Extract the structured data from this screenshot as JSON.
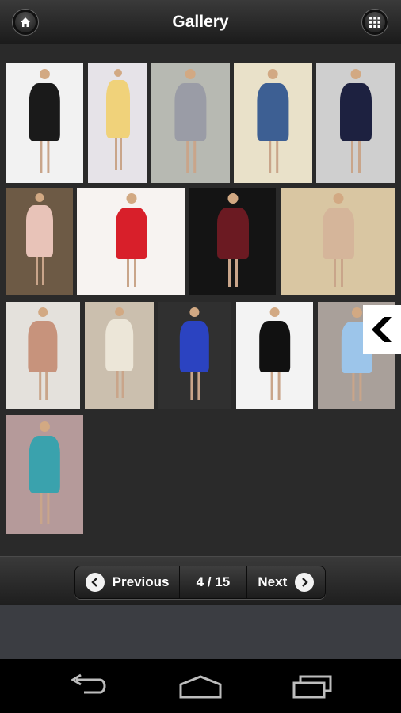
{
  "header": {
    "title": "Gallery",
    "home_icon": "home-icon",
    "grid_icon": "grid-icon"
  },
  "gallery": {
    "thumbnails": [
      {
        "bg": "#f2f2f2",
        "dress": "#1a1a1a"
      },
      {
        "bg": "#e6e3e8",
        "dress": "#f0d27a"
      },
      {
        "bg": "#b7b9b2",
        "dress": "#9a9ca6"
      },
      {
        "bg": "#e9e1c9",
        "dress": "#3d5f93"
      },
      {
        "bg": "#cfcfcf",
        "dress": "#1d2140"
      },
      {
        "bg": "#6d5a45",
        "dress": "#e8c3b8"
      },
      {
        "bg": "#f7f3f1",
        "dress": "#d81f2a"
      },
      {
        "bg": "#141414",
        "dress": "#6b1a22"
      },
      {
        "bg": "#d9c6a2",
        "dress": "#d5b59a"
      },
      {
        "bg": "#e4e1dc",
        "dress": "#c7937c"
      },
      {
        "bg": "#cbbfae",
        "dress": "#ece6d8"
      },
      {
        "bg": "#303030",
        "dress": "#2b43c1"
      },
      {
        "bg": "#f3f3f3",
        "dress": "#111111"
      },
      {
        "bg": "#a9a09a",
        "dress": "#9cc5ea"
      },
      {
        "bg": "#b59a9a",
        "dress": "#3aa2ad"
      }
    ]
  },
  "pager": {
    "previous_label": "Previous",
    "page_indicator": "4 / 15",
    "next_label": "Next"
  },
  "system_nav": {
    "back_icon": "back-icon",
    "home_icon": "home-outline-icon",
    "recents_icon": "recents-icon"
  }
}
